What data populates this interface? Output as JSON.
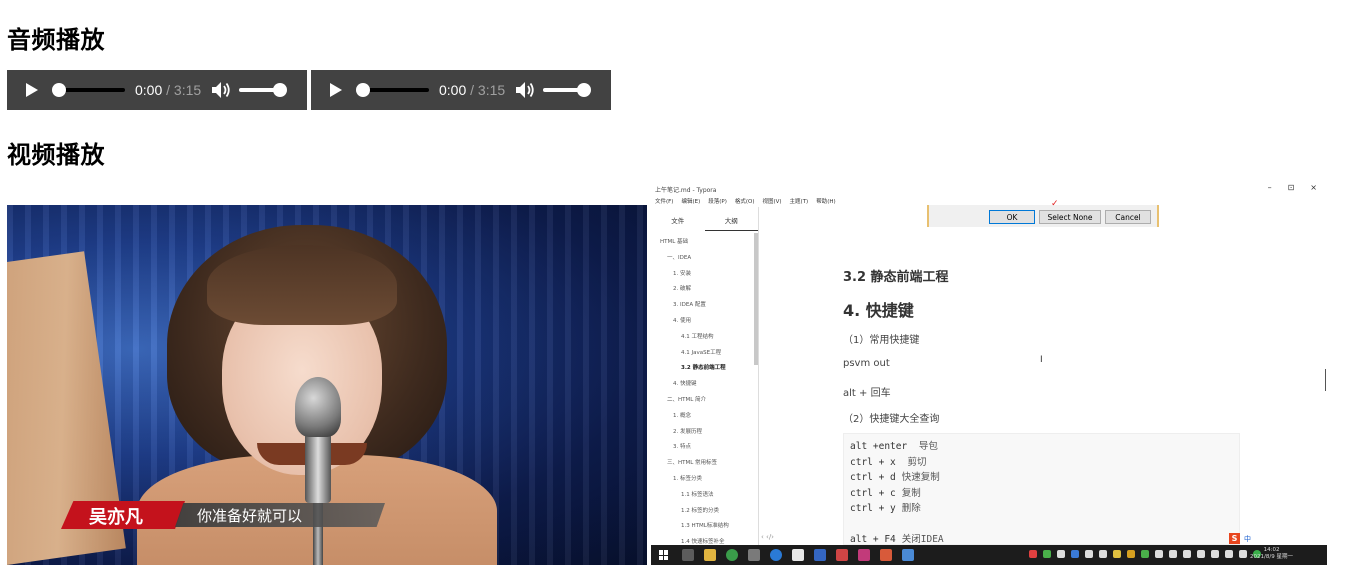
{
  "headings": {
    "audio": "音频播放",
    "video": "视频播放"
  },
  "audio_players": [
    {
      "current": "0:00",
      "separator": "/",
      "duration": "3:15",
      "progress": 0,
      "volume": 1
    },
    {
      "current": "0:00",
      "separator": "/",
      "duration": "3:15",
      "progress": 0,
      "volume": 1
    }
  ],
  "video1": {
    "name_caption": "吴亦凡",
    "subtitle": "你准备好就可以"
  },
  "video2": {
    "window_title": "上午笔记.md - Typora",
    "window_controls": [
      "–",
      "⊡",
      "×"
    ],
    "menu": [
      "文件(F)",
      "编辑(E)",
      "段落(P)",
      "格式(O)",
      "视图(V)",
      "主题(T)",
      "帮助(H)"
    ],
    "sidebar_tabs": [
      "文件",
      "大纲"
    ],
    "toc": [
      {
        "text": "HTML 基础",
        "level": 1
      },
      {
        "text": "一、IDEA",
        "level": 2
      },
      {
        "text": "1. 安装",
        "level": 3
      },
      {
        "text": "2. 破解",
        "level": 3
      },
      {
        "text": "3. IDEA 配置",
        "level": 3
      },
      {
        "text": "4. 使用",
        "level": 3
      },
      {
        "text": "4.1 工程结构",
        "level": 4
      },
      {
        "text": "4.1 JavaSE工程",
        "level": 4
      },
      {
        "text": "3.2 静态前端工程",
        "level": 4,
        "current": true
      },
      {
        "text": "4. 快捷键",
        "level": 3
      },
      {
        "text": "二、HTML 简介",
        "level": 2
      },
      {
        "text": "1. 概念",
        "level": 3
      },
      {
        "text": "2. 发展历程",
        "level": 3
      },
      {
        "text": "3. 特点",
        "level": 3
      },
      {
        "text": "三、HTML 常用标签",
        "level": 2
      },
      {
        "text": "1. 标签分类",
        "level": 3
      },
      {
        "text": "1.1 标签语法",
        "level": 4
      },
      {
        "text": "1.2 标签的分类",
        "level": 4
      },
      {
        "text": "1.3 HTML标准结构",
        "level": 4
      },
      {
        "text": "1.4 快速标签补全",
        "level": 4
      }
    ],
    "sidebar_footer": "‹  ‹/›",
    "dialog": {
      "ok": "OK",
      "select_none": "Select None",
      "cancel": "Cancel"
    },
    "doc": {
      "h3": "3.2 静态前端工程",
      "h2": "4. 快捷键",
      "p1": "（1）常用快捷键",
      "p2": "psvm out",
      "p3": "alt + 回车",
      "p4": "（2）快捷键大全查询"
    },
    "code_lines": [
      {
        "code": "alt +enter",
        "comment": "    导包"
      },
      {
        "code": "ctrl + x",
        "comment": " 剪切"
      },
      {
        "code": "ctrl + d",
        "comment": "快速复制"
      },
      {
        "code": "ctrl + c",
        "comment": "复制"
      },
      {
        "code": "ctrl + y",
        "comment": "删除"
      },
      {
        "code": "",
        "comment": ""
      },
      {
        "code": "alt + F4",
        "comment": "关闭IDEA"
      }
    ],
    "clock": {
      "time": "14:02",
      "date": "2021/8/9 星期一"
    },
    "ime": {
      "s": "S",
      "text": "中"
    }
  },
  "colors": {
    "audio_bg": "#424242",
    "audio_track": "#000000",
    "taskbar": "#1c1c1c",
    "name_red": "#c4121c"
  },
  "icons": [
    "play-icon",
    "volume-icon",
    "windows-start-icon"
  ]
}
